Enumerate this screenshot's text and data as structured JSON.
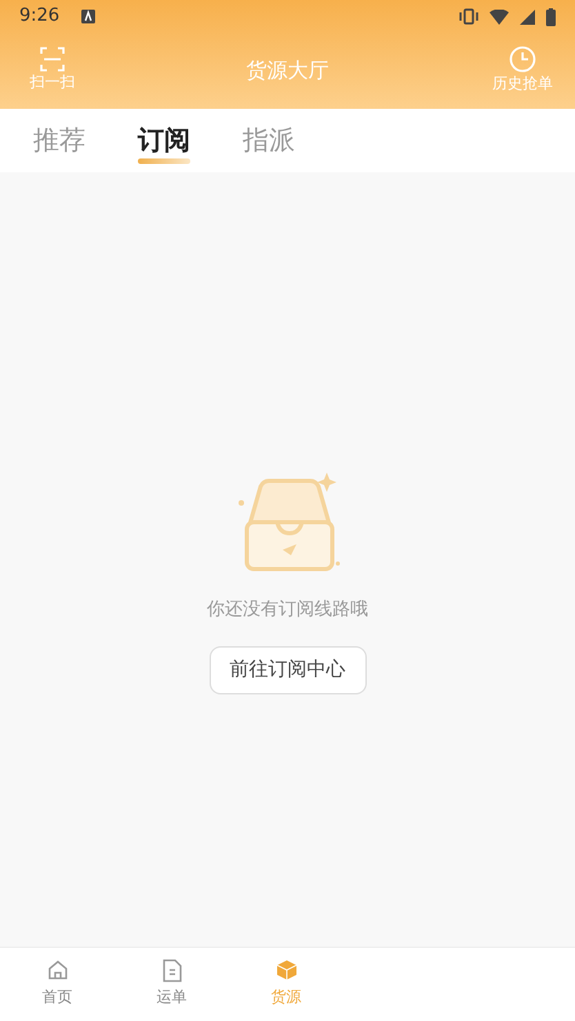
{
  "status_bar": {
    "time": "9:26"
  },
  "header": {
    "title": "货源大厅",
    "left_action": "扫一扫",
    "right_action": "历史抢单"
  },
  "tabs": [
    {
      "label": "推荐",
      "selected": false
    },
    {
      "label": "订阅",
      "selected": true
    },
    {
      "label": "指派",
      "selected": false
    }
  ],
  "empty_state": {
    "message": "你还没有订阅线路哦",
    "button": "前往订阅中心"
  },
  "bottom_nav": [
    {
      "label": "首页",
      "kind": "home",
      "selected": false
    },
    {
      "label": "运单",
      "kind": "document",
      "selected": false
    },
    {
      "label": "货源",
      "kind": "cube",
      "selected": true
    }
  ]
}
